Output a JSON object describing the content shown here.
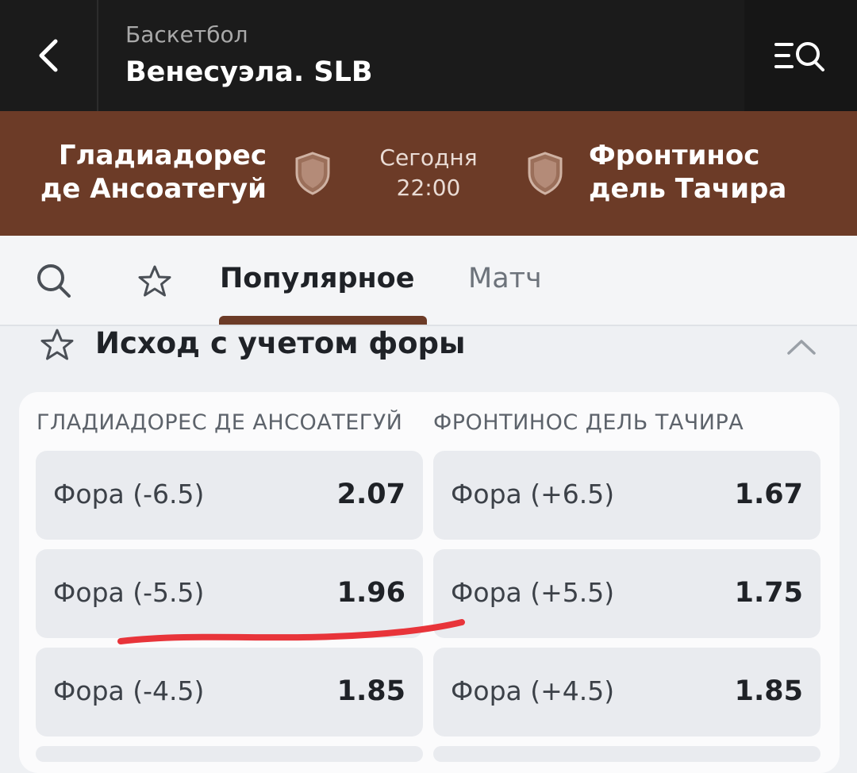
{
  "header": {
    "subtitle": "Баскетбол",
    "title": "Венесуэла. SLB"
  },
  "match": {
    "home_team": "Гладиадорес де Ансоатегуй",
    "away_team": "Фронтинос дель Тачира",
    "day": "Сегодня",
    "time": "22:00"
  },
  "tabs": {
    "items": [
      {
        "label": "Популярное",
        "active": true
      },
      {
        "label": "Матч",
        "active": false
      }
    ]
  },
  "section": {
    "title": "Исход с учетом форы"
  },
  "market": {
    "columns": [
      "ГЛАДИАДОРЕС ДЕ АНСОАТЕГУЙ",
      "ФРОНТИНОС ДЕЛЬ ТАЧИРА"
    ],
    "rows": [
      {
        "left_label": "Фора (-6.5)",
        "left_odds": "2.07",
        "right_label": "Фора (+6.5)",
        "right_odds": "1.67"
      },
      {
        "left_label": "Фора (-5.5)",
        "left_odds": "1.96",
        "right_label": "Фора (+5.5)",
        "right_odds": "1.75"
      },
      {
        "left_label": "Фора (-4.5)",
        "left_odds": "1.85",
        "right_label": "Фора (+4.5)",
        "right_odds": "1.85"
      }
    ]
  },
  "colors": {
    "accent": "#6c3b27",
    "annotation": "#e8343a"
  },
  "icons": [
    "back-arrow-icon",
    "menu-search-icon",
    "shield-icon",
    "search-icon",
    "star-icon",
    "chevron-up-icon"
  ]
}
